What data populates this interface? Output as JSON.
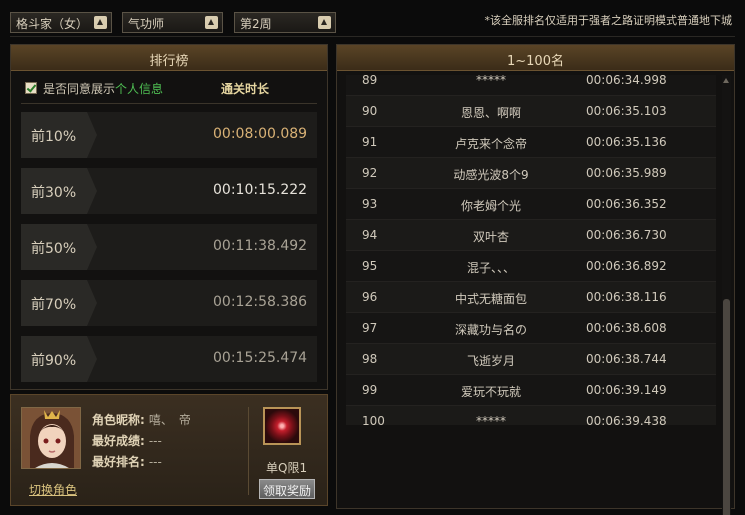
{
  "filters": {
    "job_class": "格斗家（女）",
    "sub_class": "气功师",
    "week": "第2周"
  },
  "notice": "*该全服排名仅适用于强者之路证明模式普通地下城",
  "ranking_panel": {
    "title": "排行榜",
    "checkbox_label_pre": "是否同意展示",
    "checkbox_label_link": "个人信息",
    "column_label": "通关时长",
    "tiers": [
      {
        "label": "前10%",
        "time": "00:08:00.089"
      },
      {
        "label": "前30%",
        "time": "00:10:15.222"
      },
      {
        "label": "前50%",
        "time": "00:11:38.492"
      },
      {
        "label": "前70%",
        "time": "00:12:58.386"
      },
      {
        "label": "前90%",
        "time": "00:15:25.474"
      }
    ]
  },
  "character": {
    "nickname_label": "角色昵称:",
    "nickname": "嘻、　帝",
    "best_result_label": "最好成绩:",
    "best_result": "---",
    "best_rank_label": "最好排名:",
    "best_rank": "---",
    "switch_label": "切换角色",
    "reward_label": "单Q限1",
    "claim_label": "领取奖励"
  },
  "rank_list": {
    "title": "1~100名",
    "rows": [
      {
        "rank": "89",
        "name": "*****",
        "time": "00:06:34.998"
      },
      {
        "rank": "90",
        "name": "恩恩、啊啊",
        "time": "00:06:35.103"
      },
      {
        "rank": "91",
        "name": "卢克来个念帝",
        "time": "00:06:35.136"
      },
      {
        "rank": "92",
        "name": "动感光波8个9",
        "time": "00:06:35.989"
      },
      {
        "rank": "93",
        "name": "你老姆个光",
        "time": "00:06:36.352"
      },
      {
        "rank": "94",
        "name": "双叶杏",
        "time": "00:06:36.730"
      },
      {
        "rank": "95",
        "name": "混子、、、",
        "time": "00:06:36.892"
      },
      {
        "rank": "96",
        "name": "中式无糖面包",
        "time": "00:06:38.116"
      },
      {
        "rank": "97",
        "name": "深藏功与名の",
        "time": "00:06:38.608"
      },
      {
        "rank": "98",
        "name": "飞逝岁月",
        "time": "00:06:38.744"
      },
      {
        "rank": "99",
        "name": "爱玩不玩就",
        "time": "00:06:39.149"
      },
      {
        "rank": "100",
        "name": "*****",
        "time": "00:06:39.438"
      }
    ]
  }
}
